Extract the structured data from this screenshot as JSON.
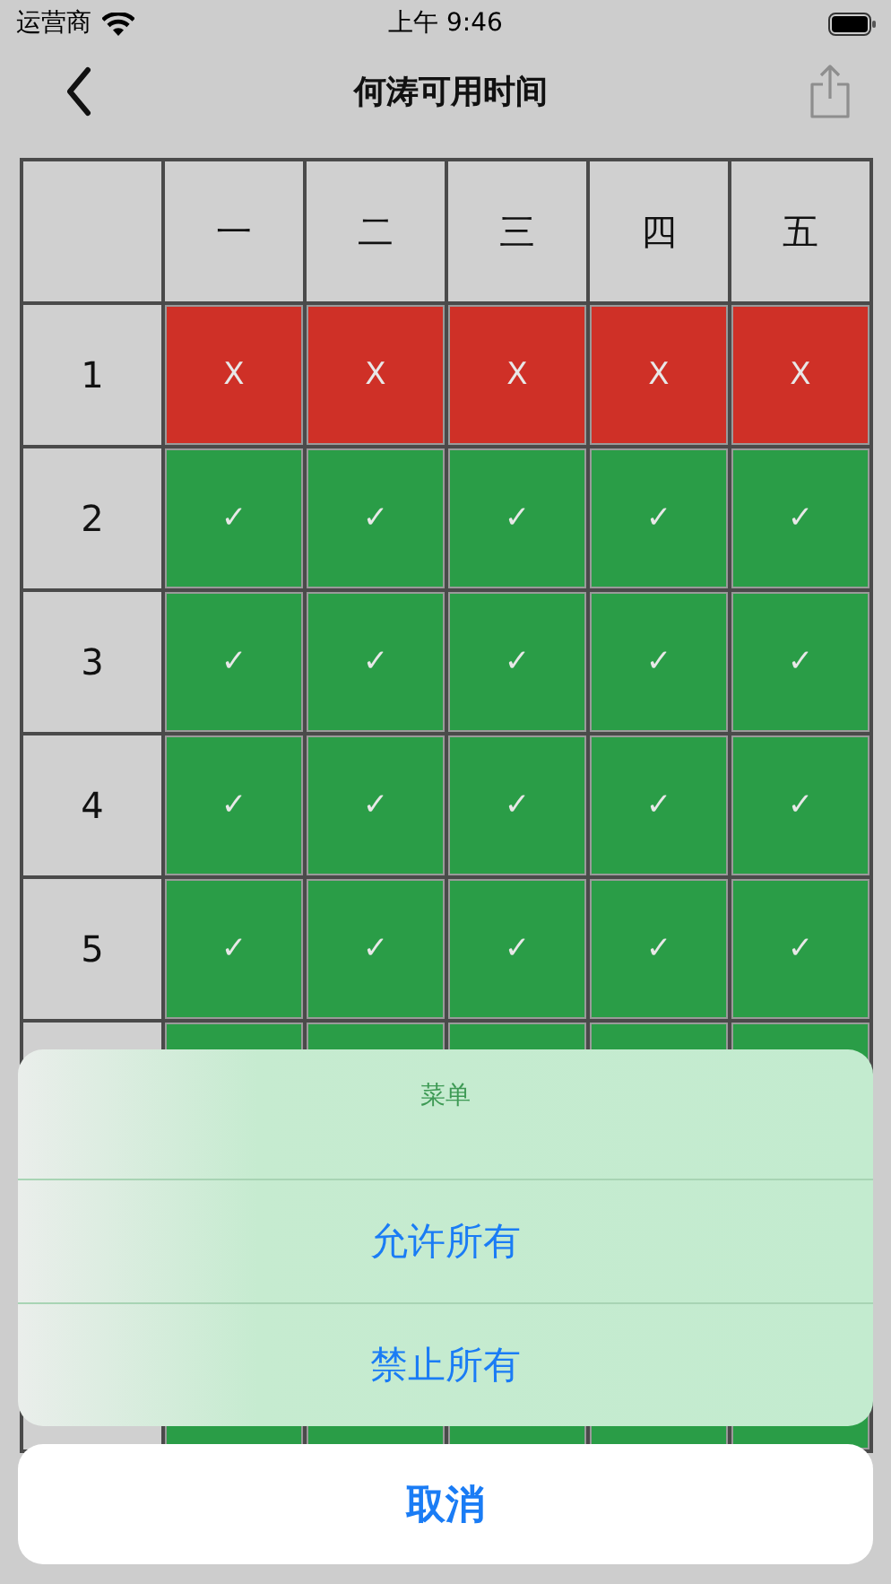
{
  "status_bar": {
    "carrier": "运营商",
    "time": "上午 9:46"
  },
  "nav": {
    "title": "何涛可用时间"
  },
  "table": {
    "columns": [
      "一",
      "二",
      "三",
      "四",
      "五"
    ],
    "rows": [
      {
        "label": "1",
        "cells": [
          {
            "available": false,
            "mark": "X"
          },
          {
            "available": false,
            "mark": "X"
          },
          {
            "available": false,
            "mark": "X"
          },
          {
            "available": false,
            "mark": "X"
          },
          {
            "available": false,
            "mark": "X"
          }
        ]
      },
      {
        "label": "2",
        "cells": [
          {
            "available": true,
            "mark": "✓"
          },
          {
            "available": true,
            "mark": "✓"
          },
          {
            "available": true,
            "mark": "✓"
          },
          {
            "available": true,
            "mark": "✓"
          },
          {
            "available": true,
            "mark": "✓"
          }
        ]
      },
      {
        "label": "3",
        "cells": [
          {
            "available": true,
            "mark": "✓"
          },
          {
            "available": true,
            "mark": "✓"
          },
          {
            "available": true,
            "mark": "✓"
          },
          {
            "available": true,
            "mark": "✓"
          },
          {
            "available": true,
            "mark": "✓"
          }
        ]
      },
      {
        "label": "4",
        "cells": [
          {
            "available": true,
            "mark": "✓"
          },
          {
            "available": true,
            "mark": "✓"
          },
          {
            "available": true,
            "mark": "✓"
          },
          {
            "available": true,
            "mark": "✓"
          },
          {
            "available": true,
            "mark": "✓"
          }
        ]
      },
      {
        "label": "5",
        "cells": [
          {
            "available": true,
            "mark": "✓"
          },
          {
            "available": true,
            "mark": "✓"
          },
          {
            "available": true,
            "mark": "✓"
          },
          {
            "available": true,
            "mark": "✓"
          },
          {
            "available": true,
            "mark": "✓"
          }
        ]
      },
      {
        "cells": [
          {
            "available": true
          },
          {
            "available": true
          },
          {
            "available": true
          },
          {
            "available": true
          },
          {
            "available": true
          }
        ]
      },
      {
        "cells": [
          {
            "available": true
          },
          {
            "available": true
          },
          {
            "available": true
          },
          {
            "available": true
          },
          {
            "available": true
          }
        ]
      }
    ]
  },
  "action_sheet": {
    "title": "菜单",
    "actions": [
      "允许所有",
      "禁止所有"
    ],
    "cancel": "取消"
  }
}
